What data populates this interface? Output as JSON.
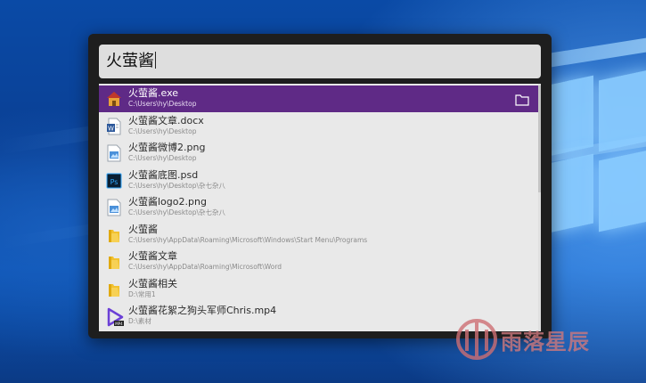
{
  "search": {
    "query": "火萤酱"
  },
  "results": [
    {
      "title": "火萤酱.exe",
      "path": "C:\\Users\\hy\\Desktop",
      "icon": "app-exe-icon",
      "selected": true
    },
    {
      "title": "火萤酱文章.docx",
      "path": "C:\\Users\\hy\\Desktop",
      "icon": "word-doc-icon",
      "selected": false
    },
    {
      "title": "火萤酱微博2.png",
      "path": "C:\\Users\\hy\\Desktop",
      "icon": "image-file-icon",
      "selected": false
    },
    {
      "title": "火萤酱底图.psd",
      "path": "C:\\Users\\hy\\Desktop\\杂七杂八",
      "icon": "photoshop-file-icon",
      "selected": false
    },
    {
      "title": "火萤酱logo2.png",
      "path": "C:\\Users\\hy\\Desktop\\杂七杂八",
      "icon": "image-file-icon",
      "selected": false
    },
    {
      "title": "火萤酱",
      "path": "C:\\Users\\hy\\AppData\\Roaming\\Microsoft\\Windows\\Start Menu\\Programs",
      "icon": "folder-icon",
      "selected": false
    },
    {
      "title": "火萤酱文章",
      "path": "C:\\Users\\hy\\AppData\\Roaming\\Microsoft\\Word",
      "icon": "folder-icon",
      "selected": false
    },
    {
      "title": "火萤酱相关",
      "path": "D:\\常用1",
      "icon": "folder-icon",
      "selected": false
    },
    {
      "title": "火萤酱花絮之狗头军师Chris.mp4",
      "path": "D:\\素材",
      "icon": "video-file-icon",
      "selected": false
    }
  ],
  "watermark": {
    "text": "雨落星辰"
  },
  "colors": {
    "selected_row": "#5f2a86",
    "results_bg": "#e9e9e9",
    "search_bg": "#dedede",
    "window_frame": "#1e1e1e"
  }
}
